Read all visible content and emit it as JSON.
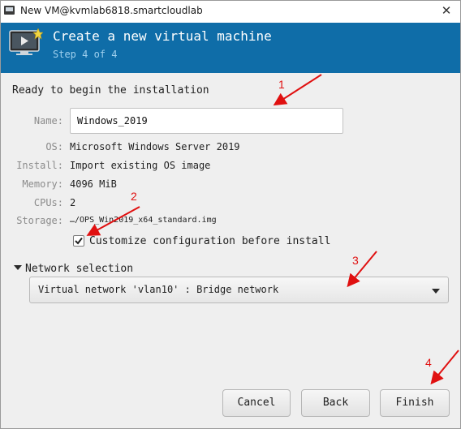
{
  "window": {
    "title": "New VM@kvmlab6818.smartcloudlab",
    "close_glyph": "✕"
  },
  "header": {
    "heading": "Create a new virtual machine",
    "step": "Step 4 of 4"
  },
  "summary": {
    "intro": "Ready to begin the installation",
    "name_label": "Name:",
    "name_value": "Windows_2019",
    "os_label": "OS:",
    "os_value": "Microsoft Windows Server 2019",
    "install_label": "Install:",
    "install_value": "Import existing OS image",
    "memory_label": "Memory:",
    "memory_value": "4096 MiB",
    "cpus_label": "CPUs:",
    "cpus_value": "2",
    "storage_label": "Storage:",
    "storage_value": "…/OPS_Win2019_x64_standard.img"
  },
  "customize": {
    "label": "Customize configuration before install",
    "checked": true
  },
  "network": {
    "expander_label": "Network selection",
    "selected": "Virtual network 'vlan10' : Bridge network"
  },
  "buttons": {
    "cancel": "Cancel",
    "back": "Back",
    "finish": "Finish"
  },
  "annotations": {
    "a1": "1",
    "a2": "2",
    "a3": "3",
    "a4": "4",
    "color": "#e01010"
  },
  "colors": {
    "banner": "#0f6da8",
    "step_text": "#9fd0ee"
  }
}
